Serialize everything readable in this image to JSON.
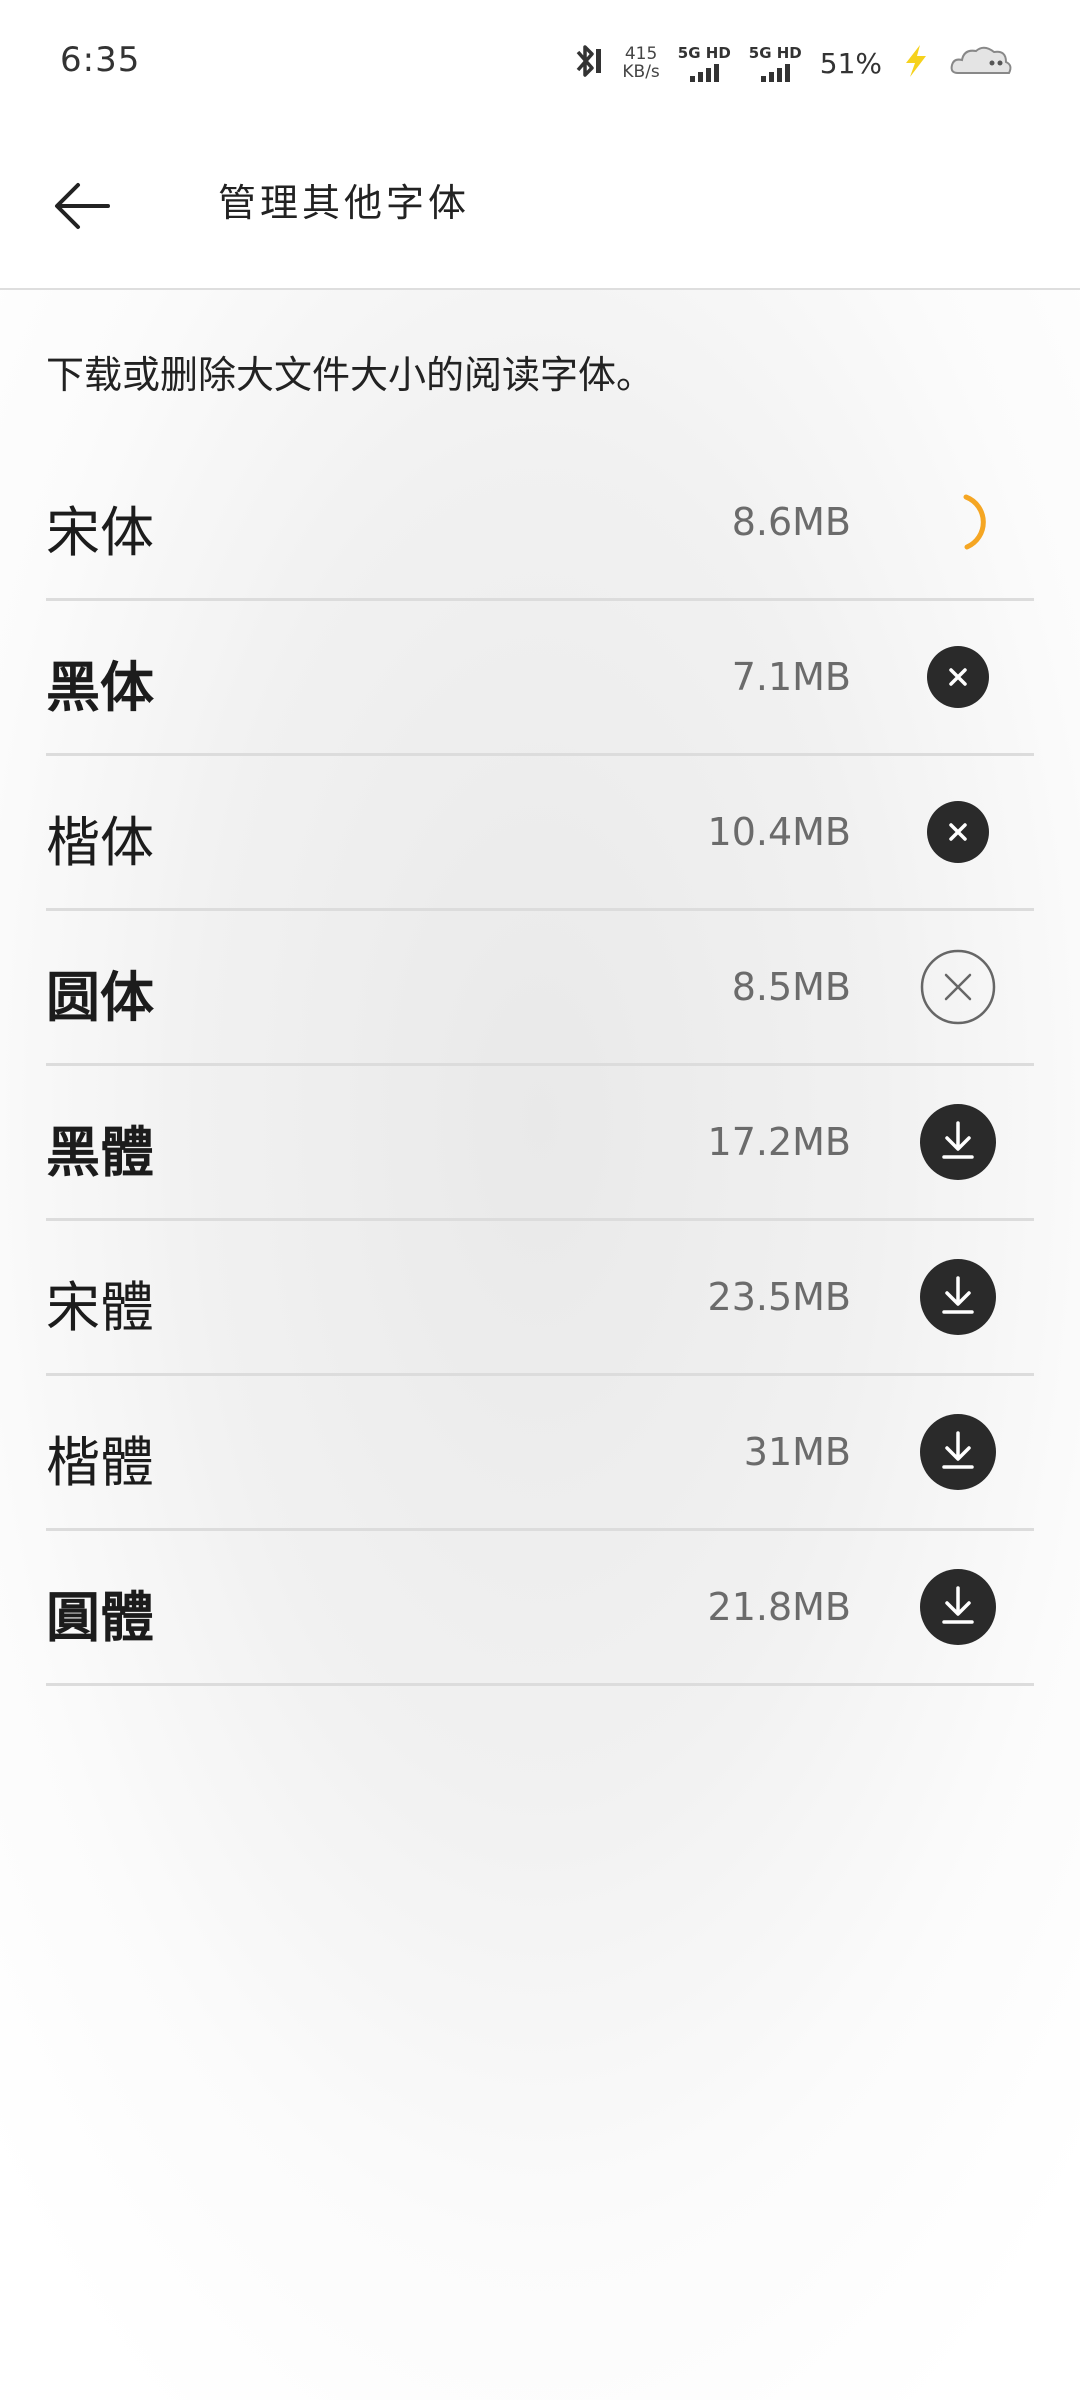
{
  "status_bar": {
    "time": "6:35",
    "net_speed_value": "415",
    "net_speed_unit": "KB/s",
    "sim1": "5G HD",
    "sim2": "5G HD",
    "battery": "51%",
    "charging_color": "#f6d21c"
  },
  "header": {
    "title": "管理其他字体",
    "back_icon": "arrow-left-icon"
  },
  "description": "下载或删除大文件大小的阅读字体。",
  "colors": {
    "accent": "#f5a623",
    "icon_dark": "#2a2a2a"
  },
  "fonts": [
    {
      "name": "宋体",
      "size": "8.6MB",
      "state": "downloading-starting"
    },
    {
      "name": "黑体",
      "size": "7.1MB",
      "state": "downloading-cancel"
    },
    {
      "name": "楷体",
      "size": "10.4MB",
      "state": "downloading-cancel"
    },
    {
      "name": "圆体",
      "size": "8.5MB",
      "state": "delete"
    },
    {
      "name": "黑體",
      "size": "17.2MB",
      "state": "download"
    },
    {
      "name": "宋體",
      "size": "23.5MB",
      "state": "download"
    },
    {
      "name": "楷體",
      "size": "31MB",
      "state": "download"
    },
    {
      "name": "圓體",
      "size": "21.8MB",
      "state": "download"
    }
  ]
}
